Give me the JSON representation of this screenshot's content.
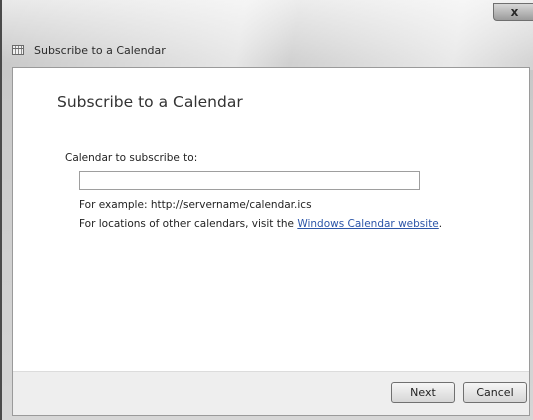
{
  "window": {
    "title": "Subscribe to a Calendar",
    "close_glyph": "x"
  },
  "dialog": {
    "heading": "Subscribe to a Calendar",
    "field_label": "Calendar to subscribe to:",
    "url_value": "",
    "url_placeholder": "",
    "example_text": "For example: http://servername/calendar.ics",
    "locations_prefix": "For locations of other calendars, visit the ",
    "locations_link": "Windows Calendar website",
    "locations_suffix": "."
  },
  "buttons": {
    "next": "Next",
    "cancel": "Cancel"
  },
  "icons": {
    "titlebar": "calendar-icon",
    "close": "close-icon"
  }
}
